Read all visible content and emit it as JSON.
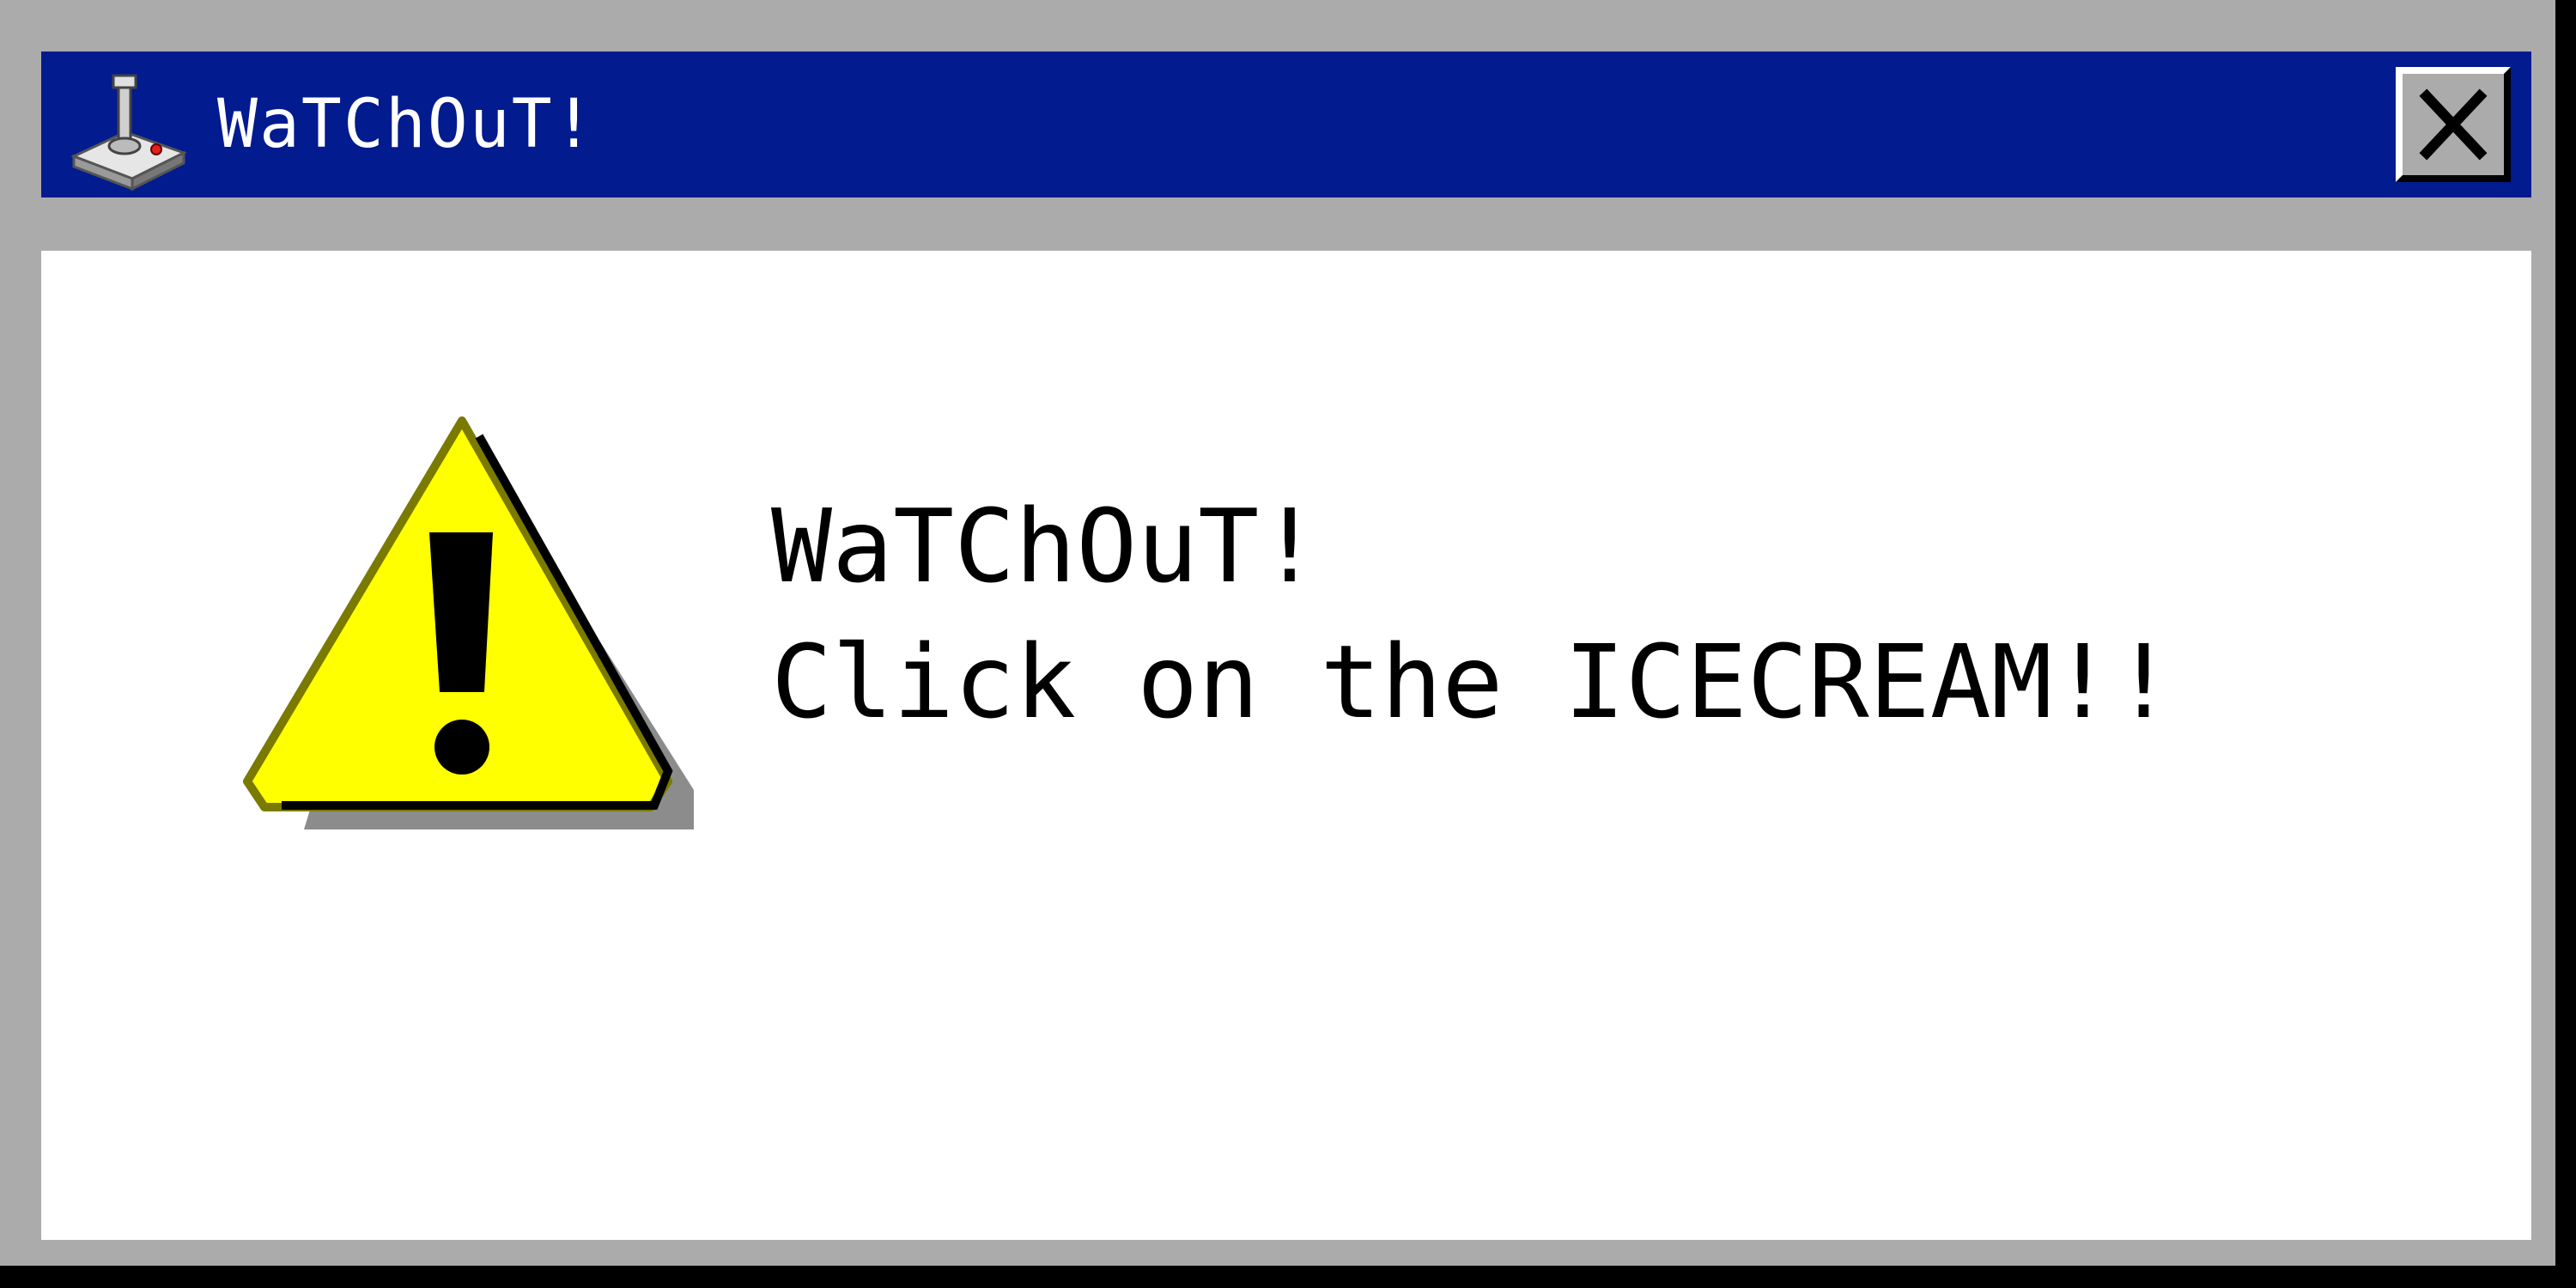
{
  "window": {
    "title": "WaTChOuT!",
    "app_icon": "joystick-icon",
    "close_icon": "close-icon"
  },
  "message": {
    "icon": "warning-icon",
    "line1": "WaTChOuT!",
    "line2": "Click on the ICECREAM!!"
  },
  "colors": {
    "titlebar": "#021b8f",
    "frame": "#ababab",
    "warning_yellow": "#ffff00"
  }
}
